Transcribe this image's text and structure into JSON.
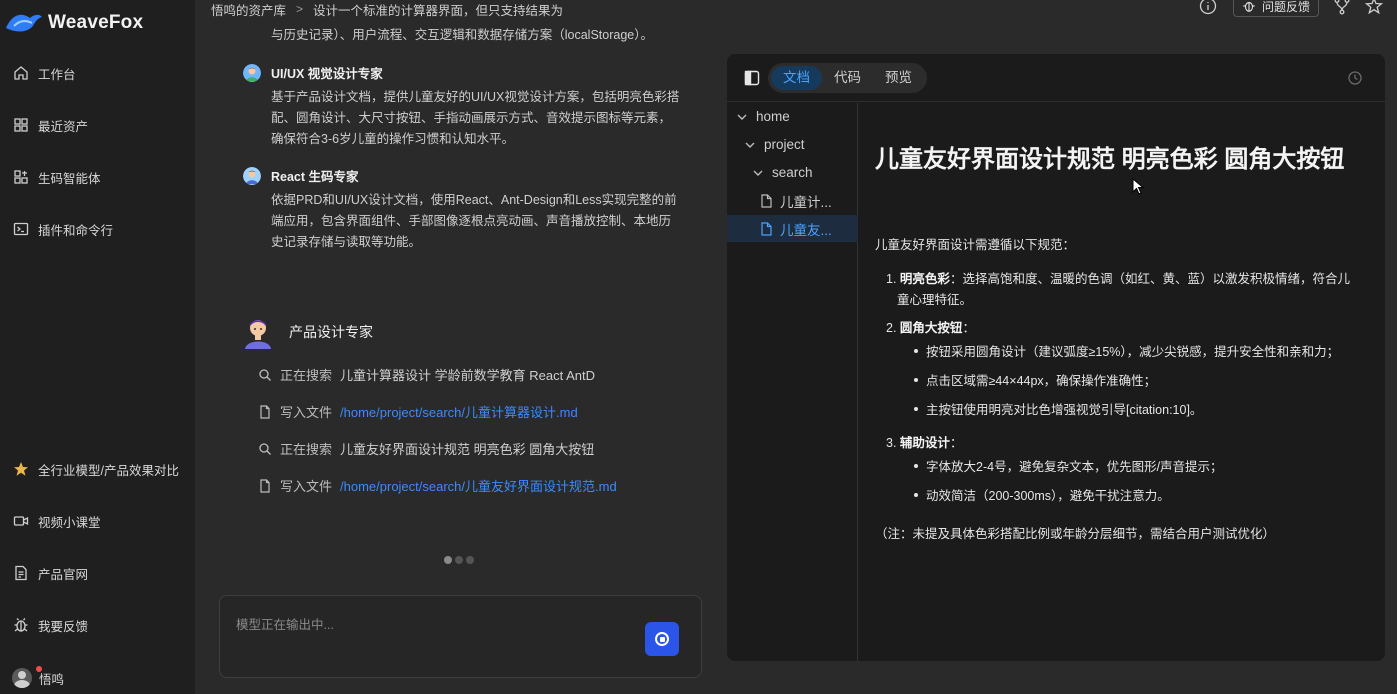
{
  "app": {
    "logo_text": "WeaveFox"
  },
  "sidebar": {
    "items": [
      {
        "label": "工作台",
        "icon": "home-icon"
      },
      {
        "label": "最近资产",
        "icon": "grid-icon"
      },
      {
        "label": "生码智能体",
        "icon": "agent-icon"
      },
      {
        "label": "插件和命令行",
        "icon": "terminal-icon"
      },
      {
        "label": "全行业模型/产品效果对比",
        "icon": "star-icon"
      },
      {
        "label": "视频小课堂",
        "icon": "video-icon"
      },
      {
        "label": "产品官网",
        "icon": "document-icon"
      },
      {
        "label": "我要反馈",
        "icon": "bug-icon"
      }
    ],
    "user": {
      "name": "悟鸣"
    }
  },
  "topbar": {
    "breadcrumb_root": "悟鸣的资产库",
    "breadcrumb_current": "设计一个标准的计算器界面，但只支持结果为",
    "feedback_label": "问题反馈"
  },
  "chat": {
    "top_fragment": "与历史记录）、用户流程、交互逻辑和数据存储方案（localStorage）。",
    "experts": [
      {
        "name": "UI/UX 视觉设计专家",
        "desc": "基于产品设计文档，提供儿童友好的UI/UX视觉设计方案，包括明亮色彩搭配、圆角设计、大尺寸按钮、手指动画展示方式、音效提示图标等元素，确保符合3-6岁儿童的操作习惯和认知水平。"
      },
      {
        "name": "React 生码专家",
        "desc": "依据PRD和UI/UX设计文档，使用React、Ant-Design和Less实现完整的前端应用，包含界面组件、手部图像逐根点亮动画、声音播放控制、本地历史记录存储与读取等功能。"
      }
    ],
    "active_expert": "产品设计专家",
    "steps": [
      {
        "verb": "正在搜索",
        "object": "儿童计算器设计 学龄前数学教育 React AntD",
        "type": "search"
      },
      {
        "verb": "写入文件",
        "object": "/home/project/search/儿童计算器设计.md",
        "type": "file"
      },
      {
        "verb": "正在搜索",
        "object": "儿童友好界面设计规范 明亮色彩 圆角大按钮",
        "type": "search"
      },
      {
        "verb": "写入文件",
        "object": "/home/project/search/儿童友好界面设计规范.md",
        "type": "file"
      }
    ],
    "input_placeholder": "模型正在输出中..."
  },
  "panel": {
    "tabs": [
      {
        "label": "文档",
        "active": true
      },
      {
        "label": "代码",
        "active": false
      },
      {
        "label": "预览",
        "active": false
      }
    ],
    "tree": [
      {
        "label": "home",
        "kind": "folder"
      },
      {
        "label": "project",
        "kind": "folder"
      },
      {
        "label": "search",
        "kind": "folder"
      },
      {
        "label": "儿童计...",
        "kind": "file"
      },
      {
        "label": "儿童友...",
        "kind": "file",
        "selected": true
      }
    ],
    "doc": {
      "title": "儿童友好界面设计规范 明亮色彩 圆角大按钮",
      "intro": "儿童友好界面设计需遵循以下规范：",
      "sections": [
        {
          "num": "1.",
          "heading": "明亮色彩",
          "text": "：选择高饱和度、温暖的色调（如红、黄、蓝）以激发积极情绪，符合儿童心理特征。",
          "bullets": []
        },
        {
          "num": "2.",
          "heading": "圆角大按钮",
          "text": "：",
          "bullets": [
            "按钮采用圆角设计（建议弧度≥15%），减少尖锐感，提升安全性和亲和力；",
            "点击区域需≥44×44px，确保操作准确性；",
            "主按钮使用明亮对比色增强视觉引导[citation:10]。"
          ]
        },
        {
          "num": "3.",
          "heading": "辅助设计",
          "text": "：",
          "bullets": [
            "字体放大2-4号，避免复杂文本，优先图形/声音提示；",
            "动效简洁（200-300ms），避免干扰注意力。"
          ]
        }
      ],
      "note": "（注：未提及具体色彩搭配比例或年龄分层细节，需结合用户测试优化）"
    }
  },
  "colors": {
    "accent": "#3b8bff",
    "stop_button": "#2b54e8",
    "tab_active_bg": "#163a5c"
  }
}
